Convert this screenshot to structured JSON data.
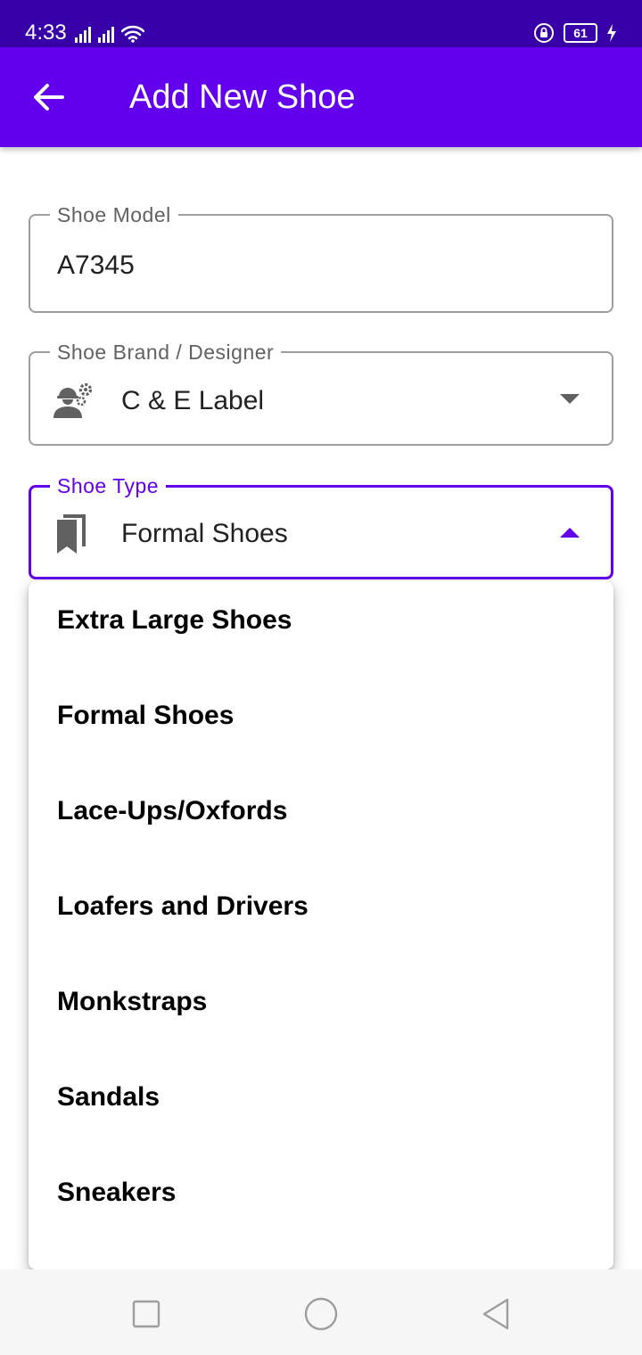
{
  "status_bar": {
    "time": "4:33",
    "battery_level": "61"
  },
  "app_bar": {
    "title": "Add New Shoe",
    "background": "#6200ee"
  },
  "form": {
    "shoe_model": {
      "label": "Shoe Model",
      "value": "A7345"
    },
    "shoe_brand": {
      "label": "Shoe Brand / Designer",
      "value": "C & E Label",
      "icon": "engineer-gears-icon"
    },
    "shoe_type": {
      "label": "Shoe Type",
      "value": "Formal Shoes",
      "icon": "bookmarks-icon",
      "state": "expanded",
      "accent": "#6200ee"
    }
  },
  "dropdown_menu": {
    "items": [
      {
        "label": "Extra Large Shoes"
      },
      {
        "label": "Formal Shoes"
      },
      {
        "label": "Lace-Ups/Oxfords"
      },
      {
        "label": "Loafers and Drivers"
      },
      {
        "label": "Monkstraps"
      },
      {
        "label": "Sandals"
      },
      {
        "label": "Sneakers"
      }
    ]
  },
  "nav_bar": {
    "buttons": [
      {
        "icon": "square-recents-icon"
      },
      {
        "icon": "circle-home-icon"
      },
      {
        "icon": "triangle-back-icon"
      }
    ]
  }
}
